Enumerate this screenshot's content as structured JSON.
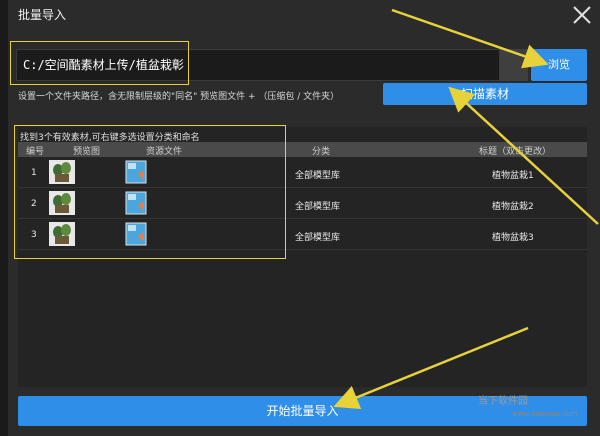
{
  "dialog": {
    "title": "批量导入"
  },
  "path": {
    "value": "C:/空间酷素材上传/植盆栽彰"
  },
  "buttons": {
    "browse": "浏览",
    "scan": "扫描素材",
    "start": "开始批量导入"
  },
  "hint": "设置一个文件夹路径，含无限制层级的\"同名\" 预览图文件 + （压缩包 / 文件夹）",
  "list": {
    "found_text": "找到3个有效素材,可右键多选设置分类和命名",
    "columns": [
      "编号",
      "预览图",
      "资源文件",
      "分类",
      "标题（双击更改）"
    ],
    "rows": [
      {
        "num": "1",
        "category": "全部模型库",
        "label": "植物盆栽1"
      },
      {
        "num": "2",
        "category": "全部模型库",
        "label": "植物盆栽2"
      },
      {
        "num": "3",
        "category": "全部模型库",
        "label": "植物盆栽3"
      }
    ]
  },
  "watermark": {
    "text": "当下软件园",
    "url": "www.downxia.com"
  },
  "colors": {
    "accent": "#2f8ee8",
    "highlight": "#e8d23a",
    "background": "#2b2b2b"
  },
  "icons": [
    "close-icon",
    "plant-thumbnail-icon",
    "file-icon",
    "arrow-annotation-icon"
  ]
}
